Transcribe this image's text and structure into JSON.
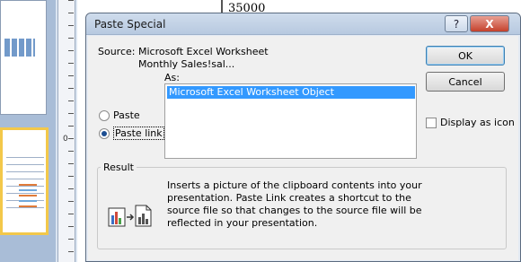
{
  "background": {
    "chart_axis_label": "35000"
  },
  "dialog": {
    "title": "Paste Special",
    "help_glyph": "?",
    "close_glyph": "X",
    "source_label": "Source:",
    "source_value": "Microsoft Excel Worksheet",
    "source_path": "Monthly Sales!sal...",
    "as_label": "As:",
    "as_options": [
      "Microsoft Excel Worksheet Object"
    ],
    "selected_option": "Microsoft Excel Worksheet Object",
    "paste_option": "Paste",
    "paste_link_option": "Paste link",
    "selected_mode": "Paste link",
    "ok_label": "OK",
    "cancel_label": "Cancel",
    "display_as_icon_label": "Display as icon",
    "display_as_icon_checked": false,
    "result_label": "Result",
    "result_text": "Inserts a picture of the clipboard contents into your presentation. Paste Link creates a shortcut to the source file so that changes to the source file will be reflected in your presentation.",
    "result_icon": "paste-link-chart-icon"
  }
}
